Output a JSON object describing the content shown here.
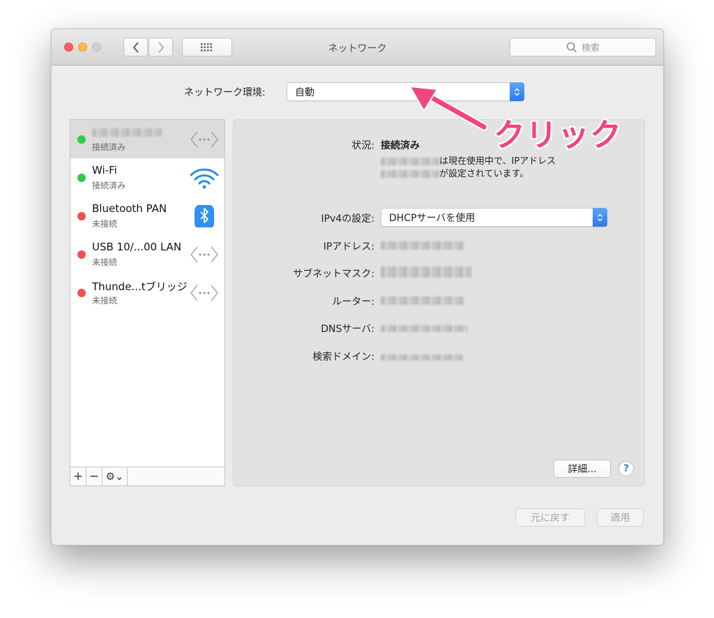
{
  "window": {
    "title": "ネットワーク",
    "search_placeholder": "検索"
  },
  "location": {
    "label": "ネットワーク環境:",
    "value": "自動"
  },
  "services": [
    {
      "name": "",
      "status": "接続済み",
      "state": "connected",
      "icon": "ethernet-icon",
      "selected": true
    },
    {
      "name": "Wi-Fi",
      "status": "接続済み",
      "state": "connected",
      "icon": "wifi-icon"
    },
    {
      "name": "Bluetooth PAN",
      "status": "未接続",
      "state": "disconnected",
      "icon": "bluetooth-icon"
    },
    {
      "name": "USB 10/...00 LAN",
      "status": "未接続",
      "state": "disconnected",
      "icon": "ethernet-icon"
    },
    {
      "name": "Thunde...tブリッジ",
      "status": "未接続",
      "state": "disconnected",
      "icon": "ethernet-icon"
    }
  ],
  "sidebar_actions": {
    "add": "+",
    "remove": "−",
    "gear": "⚙︎⌄"
  },
  "detail": {
    "status_label": "状況:",
    "status_value": "接続済み",
    "status_desc_line1": "は現在使用中で、IPアドレス",
    "status_desc_line2": "が設定されています。",
    "ipv4_label": "IPv4の設定:",
    "ipv4_value": "DHCPサーバを使用",
    "ip_label": "IPアドレス:",
    "subnet_label": "サブネットマスク:",
    "router_label": "ルーター:",
    "dns_label": "DNSサーバ:",
    "search_domain_label": "検索ドメイン:",
    "advanced_button": "詳細...",
    "help_button": "?"
  },
  "footer": {
    "revert_button": "元に戻す",
    "apply_button": "適用"
  },
  "annotation": {
    "text": "クリック",
    "color": "#f2447f"
  },
  "colors": {
    "connected": "#2fcb4a",
    "disconnected": "#f0514d",
    "accent": "#2a79ea"
  }
}
